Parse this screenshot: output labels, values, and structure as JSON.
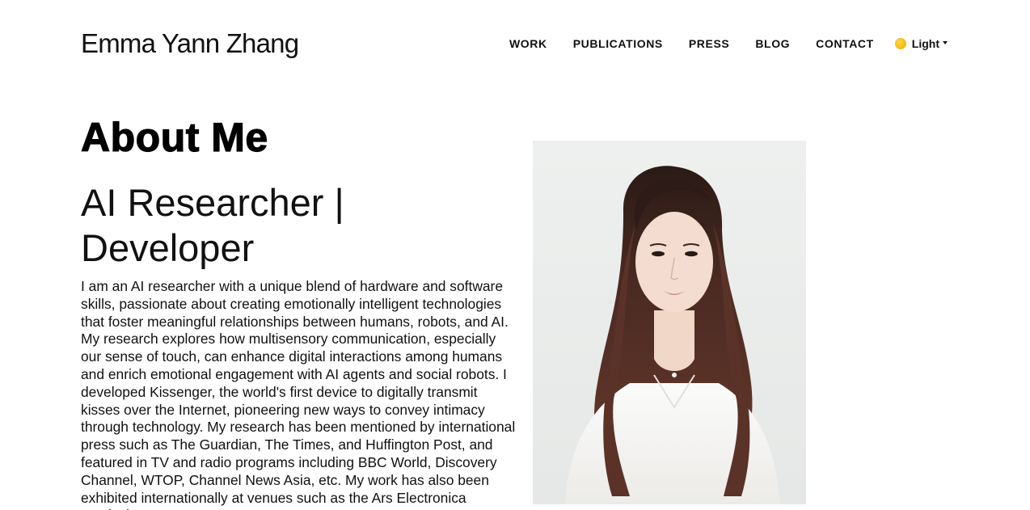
{
  "header": {
    "site_title": "Emma Yann Zhang",
    "nav": [
      {
        "label": "WORK"
      },
      {
        "label": "PUBLICATIONS"
      },
      {
        "label": "PRESS"
      },
      {
        "label": "BLOG"
      },
      {
        "label": "CONTACT"
      }
    ],
    "theme_toggle": {
      "label": "Light",
      "icon": "sun-icon"
    }
  },
  "main": {
    "heading": "About Me",
    "role": "AI Researcher | Developer",
    "bio": "I am an AI researcher with a unique blend of hardware and software skills, passionate about creating emotionally intelligent technologies that foster meaningful relationships between humans, robots, and AI. My research explores how multisensory communication, especially our sense of touch, can enhance digital interactions among humans and enrich emotional engagement with AI agents and social robots. I developed Kissenger, the world's first device to digitally transmit kisses over the Internet, pioneering new ways to convey intimacy through technology. My research has been mentioned by international press such as The Guardian, The Times, and Huffington Post, and featured in TV and radio programs including BBC World, Discovery Channel, WTOP, Channel News Asia, etc. My work has also been exhibited internationally at venues such as the Ars Electronica Festival"
  },
  "colors": {
    "text": "#111111",
    "background": "#ffffff",
    "sun": "#f5b300"
  }
}
